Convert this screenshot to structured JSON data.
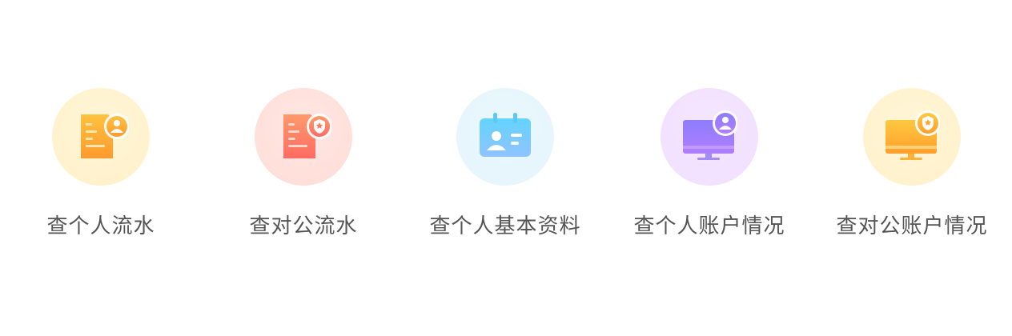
{
  "items": [
    {
      "label": "查个人流水",
      "icon": "personal-statement-icon"
    },
    {
      "label": "查对公流水",
      "icon": "corporate-statement-icon"
    },
    {
      "label": "查个人基本资料",
      "icon": "personal-id-card-icon"
    },
    {
      "label": "查个人账户情况",
      "icon": "personal-account-monitor-icon"
    },
    {
      "label": "查对公账户情况",
      "icon": "corporate-account-monitor-icon"
    }
  ]
}
